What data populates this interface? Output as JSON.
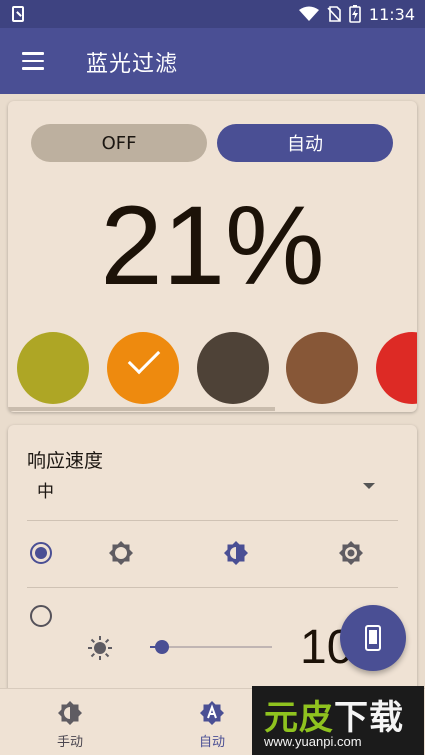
{
  "status_bar": {
    "time": "11:34"
  },
  "app_bar": {
    "title": "蓝光过滤"
  },
  "mode_toggle": {
    "off_label": "OFF",
    "auto_label": "自动",
    "selected": "auto"
  },
  "filter": {
    "intensity_text": "21%"
  },
  "color_swatches": [
    {
      "name": "olive",
      "color": "#aea625",
      "selected": false
    },
    {
      "name": "amber",
      "color": "#ee8a0e",
      "selected": true
    },
    {
      "name": "dark-brown",
      "color": "#4e4237",
      "selected": false
    },
    {
      "name": "brown",
      "color": "#875737",
      "selected": false
    },
    {
      "name": "red",
      "color": "#dd2a25",
      "selected": false
    }
  ],
  "response_speed": {
    "label": "响应速度",
    "value": "中"
  },
  "brightness": {
    "slider_value_text": "10",
    "slider_level": 0.1
  },
  "bottom_nav": {
    "manual_label": "手动",
    "auto_label": "自动",
    "selected": "auto"
  },
  "watermark": {
    "brand_green": "元皮",
    "brand_white": "下载",
    "url": "www.yuanpi.com"
  },
  "colors": {
    "primary": "#4a4f94",
    "status_bar": "#3e4381",
    "background": "#e9dccd",
    "card": "#efe2d4"
  }
}
